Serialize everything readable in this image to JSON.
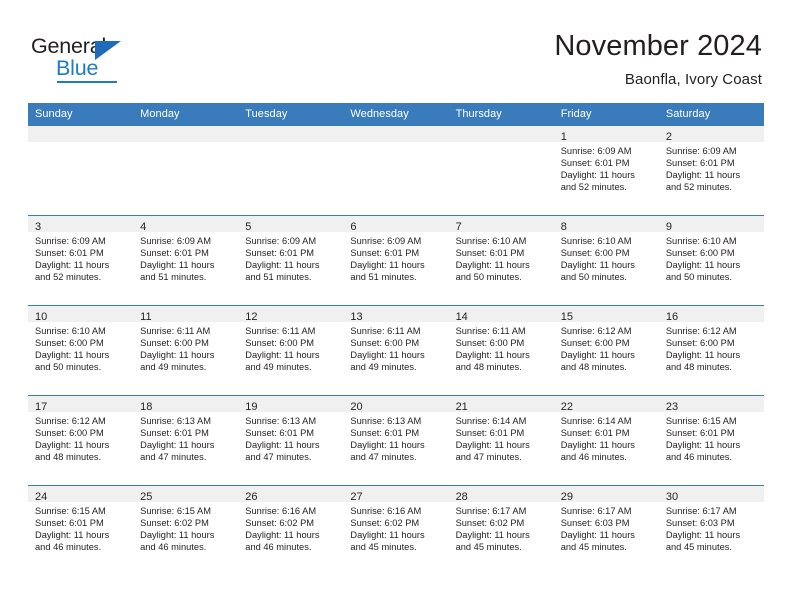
{
  "brand": {
    "name_part1": "General",
    "name_part2": "Blue",
    "triangle_icon": "triangle-icon",
    "accent_color": "#1e7bc4"
  },
  "header": {
    "title": "November 2024",
    "subtitle": "Baonfla, Ivory Coast"
  },
  "colors": {
    "header_blue": "#3a7cbb",
    "day_band_gray": "#f0f0f0",
    "text": "#231f20"
  },
  "weekdays": [
    "Sunday",
    "Monday",
    "Tuesday",
    "Wednesday",
    "Thursday",
    "Friday",
    "Saturday"
  ],
  "weeks": [
    [
      {
        "day": "",
        "lines": []
      },
      {
        "day": "",
        "lines": []
      },
      {
        "day": "",
        "lines": []
      },
      {
        "day": "",
        "lines": []
      },
      {
        "day": "",
        "lines": []
      },
      {
        "day": "1",
        "lines": [
          "Sunrise: 6:09 AM",
          "Sunset: 6:01 PM",
          "Daylight: 11 hours",
          "and 52 minutes."
        ]
      },
      {
        "day": "2",
        "lines": [
          "Sunrise: 6:09 AM",
          "Sunset: 6:01 PM",
          "Daylight: 11 hours",
          "and 52 minutes."
        ]
      }
    ],
    [
      {
        "day": "3",
        "lines": [
          "Sunrise: 6:09 AM",
          "Sunset: 6:01 PM",
          "Daylight: 11 hours",
          "and 52 minutes."
        ]
      },
      {
        "day": "4",
        "lines": [
          "Sunrise: 6:09 AM",
          "Sunset: 6:01 PM",
          "Daylight: 11 hours",
          "and 51 minutes."
        ]
      },
      {
        "day": "5",
        "lines": [
          "Sunrise: 6:09 AM",
          "Sunset: 6:01 PM",
          "Daylight: 11 hours",
          "and 51 minutes."
        ]
      },
      {
        "day": "6",
        "lines": [
          "Sunrise: 6:09 AM",
          "Sunset: 6:01 PM",
          "Daylight: 11 hours",
          "and 51 minutes."
        ]
      },
      {
        "day": "7",
        "lines": [
          "Sunrise: 6:10 AM",
          "Sunset: 6:01 PM",
          "Daylight: 11 hours",
          "and 50 minutes."
        ]
      },
      {
        "day": "8",
        "lines": [
          "Sunrise: 6:10 AM",
          "Sunset: 6:00 PM",
          "Daylight: 11 hours",
          "and 50 minutes."
        ]
      },
      {
        "day": "9",
        "lines": [
          "Sunrise: 6:10 AM",
          "Sunset: 6:00 PM",
          "Daylight: 11 hours",
          "and 50 minutes."
        ]
      }
    ],
    [
      {
        "day": "10",
        "lines": [
          "Sunrise: 6:10 AM",
          "Sunset: 6:00 PM",
          "Daylight: 11 hours",
          "and 50 minutes."
        ]
      },
      {
        "day": "11",
        "lines": [
          "Sunrise: 6:11 AM",
          "Sunset: 6:00 PM",
          "Daylight: 11 hours",
          "and 49 minutes."
        ]
      },
      {
        "day": "12",
        "lines": [
          "Sunrise: 6:11 AM",
          "Sunset: 6:00 PM",
          "Daylight: 11 hours",
          "and 49 minutes."
        ]
      },
      {
        "day": "13",
        "lines": [
          "Sunrise: 6:11 AM",
          "Sunset: 6:00 PM",
          "Daylight: 11 hours",
          "and 49 minutes."
        ]
      },
      {
        "day": "14",
        "lines": [
          "Sunrise: 6:11 AM",
          "Sunset: 6:00 PM",
          "Daylight: 11 hours",
          "and 48 minutes."
        ]
      },
      {
        "day": "15",
        "lines": [
          "Sunrise: 6:12 AM",
          "Sunset: 6:00 PM",
          "Daylight: 11 hours",
          "and 48 minutes."
        ]
      },
      {
        "day": "16",
        "lines": [
          "Sunrise: 6:12 AM",
          "Sunset: 6:00 PM",
          "Daylight: 11 hours",
          "and 48 minutes."
        ]
      }
    ],
    [
      {
        "day": "17",
        "lines": [
          "Sunrise: 6:12 AM",
          "Sunset: 6:00 PM",
          "Daylight: 11 hours",
          "and 48 minutes."
        ]
      },
      {
        "day": "18",
        "lines": [
          "Sunrise: 6:13 AM",
          "Sunset: 6:01 PM",
          "Daylight: 11 hours",
          "and 47 minutes."
        ]
      },
      {
        "day": "19",
        "lines": [
          "Sunrise: 6:13 AM",
          "Sunset: 6:01 PM",
          "Daylight: 11 hours",
          "and 47 minutes."
        ]
      },
      {
        "day": "20",
        "lines": [
          "Sunrise: 6:13 AM",
          "Sunset: 6:01 PM",
          "Daylight: 11 hours",
          "and 47 minutes."
        ]
      },
      {
        "day": "21",
        "lines": [
          "Sunrise: 6:14 AM",
          "Sunset: 6:01 PM",
          "Daylight: 11 hours",
          "and 47 minutes."
        ]
      },
      {
        "day": "22",
        "lines": [
          "Sunrise: 6:14 AM",
          "Sunset: 6:01 PM",
          "Daylight: 11 hours",
          "and 46 minutes."
        ]
      },
      {
        "day": "23",
        "lines": [
          "Sunrise: 6:15 AM",
          "Sunset: 6:01 PM",
          "Daylight: 11 hours",
          "and 46 minutes."
        ]
      }
    ],
    [
      {
        "day": "24",
        "lines": [
          "Sunrise: 6:15 AM",
          "Sunset: 6:01 PM",
          "Daylight: 11 hours",
          "and 46 minutes."
        ]
      },
      {
        "day": "25",
        "lines": [
          "Sunrise: 6:15 AM",
          "Sunset: 6:02 PM",
          "Daylight: 11 hours",
          "and 46 minutes."
        ]
      },
      {
        "day": "26",
        "lines": [
          "Sunrise: 6:16 AM",
          "Sunset: 6:02 PM",
          "Daylight: 11 hours",
          "and 46 minutes."
        ]
      },
      {
        "day": "27",
        "lines": [
          "Sunrise: 6:16 AM",
          "Sunset: 6:02 PM",
          "Daylight: 11 hours",
          "and 45 minutes."
        ]
      },
      {
        "day": "28",
        "lines": [
          "Sunrise: 6:17 AM",
          "Sunset: 6:02 PM",
          "Daylight: 11 hours",
          "and 45 minutes."
        ]
      },
      {
        "day": "29",
        "lines": [
          "Sunrise: 6:17 AM",
          "Sunset: 6:03 PM",
          "Daylight: 11 hours",
          "and 45 minutes."
        ]
      },
      {
        "day": "30",
        "lines": [
          "Sunrise: 6:17 AM",
          "Sunset: 6:03 PM",
          "Daylight: 11 hours",
          "and 45 minutes."
        ]
      }
    ]
  ]
}
